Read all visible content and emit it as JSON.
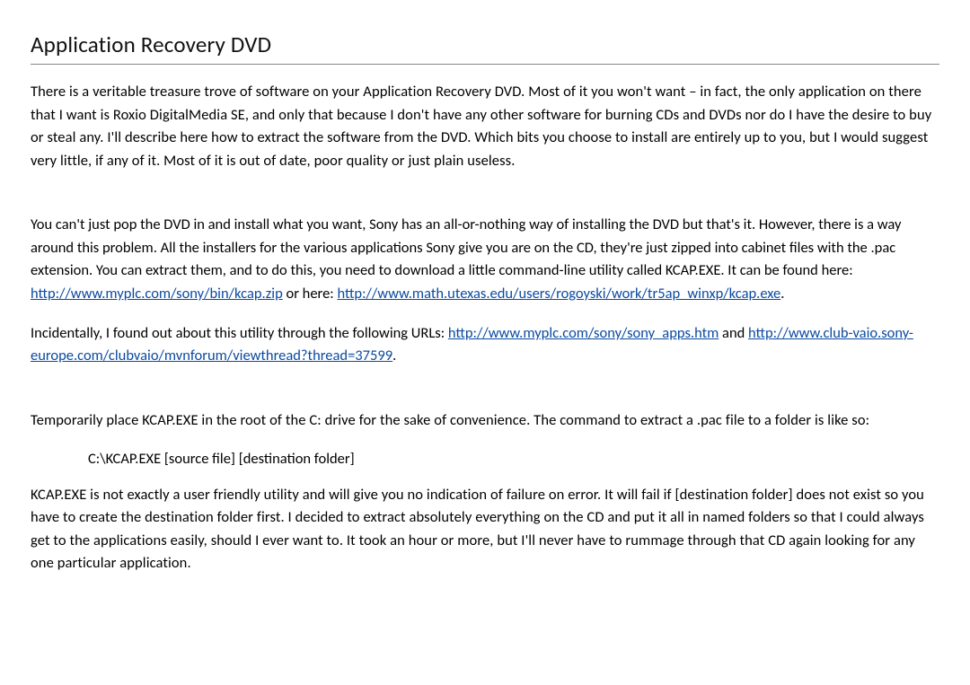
{
  "title": "Application Recovery DVD",
  "paragraphs": {
    "p1": "There is a veritable treasure trove of software on your Application Recovery DVD. Most of it you won't want – in fact, the only application on there that I want is Roxio DigitalMedia SE, and only that because I don't have any other software for burning CDs and DVDs nor do I have the desire to buy or steal any. I'll describe here how to extract the software from the DVD. Which bits you choose to install are entirely up to you, but I would suggest very little, if any of it. Most of it is out of date, poor quality or just plain useless.",
    "p2_pre": "You can't just pop the DVD in and install what you want, Sony has an all-or-nothing way of installing the DVD but that's it. However, there is a way around this problem. All the installers for the various applications Sony give you are on the CD, they're just zipped into cabinet files with the .pac extension. You can extract them, and to do this, you need to download a little command-line utility called KCAP.EXE. It can be found here: ",
    "p2_link1": "http://www.myplc.com/sony/bin/kcap.zip",
    "p2_mid": " or here: ",
    "p2_link2": "http://www.math.utexas.edu/users/rogoyski/work/tr5ap_winxp/kcap.exe",
    "p2_end": ".",
    "p3_pre": "Incidentally, I found out about this utility through the following URLs: ",
    "p3_link1": "http://www.myplc.com/sony/sony_apps.htm",
    "p3_mid": " and ",
    "p3_link2": "http://www.club-vaio.sony-europe.com/clubvaio/mvnforum/viewthread?thread=37599",
    "p3_end": ".",
    "p4": "Temporarily place KCAP.EXE in the root of the C: drive for the sake of convenience. The command to extract a .pac file to a folder is like so:",
    "cmd": "C:\\KCAP.EXE [source file] [destination folder]",
    "p5": "KCAP.EXE is not exactly a user friendly utility and will give you no indication of failure on error. It will fail if [destination folder] does not exist so you have to create the destination folder first. I decided to extract absolutely everything on the CD and put it all in named folders so that I could always get to the applications easily, should I ever want to. It took an hour or more, but I'll never have to rummage through that CD again looking for any one particular application."
  }
}
